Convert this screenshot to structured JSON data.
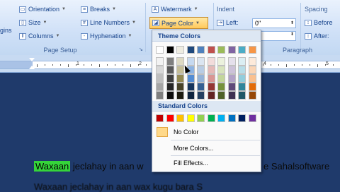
{
  "ribbon": {
    "margins_partial": "gins",
    "orientation": "Orientation",
    "size": "Size",
    "columns": "Columns",
    "breaks": "Breaks",
    "line_numbers": "Line Numbers",
    "hyphenation": "Hyphenation",
    "watermark": "Watermark",
    "page_color": "Page Color",
    "indent_label": "Indent",
    "indent_left_label": "Left:",
    "indent_left_value": "0\"",
    "spacing_label": "Spacing",
    "spacing_before": "Before",
    "spacing_after": "After:",
    "group_page_setup": "Page Setup",
    "group_paragraph": "Paragraph"
  },
  "ruler": {
    "numbers": [
      "1",
      "2",
      "3",
      "4",
      "5"
    ]
  },
  "menu": {
    "theme_header": "Theme Colors",
    "standard_header": "Standard Colors",
    "no_color": "No Color",
    "more_colors": "More Colors...",
    "fill_effects": "Fill Effects...",
    "theme_top_row": [
      "#ffffff",
      "#000000",
      "#eeece1",
      "#1f497d",
      "#4f81bd",
      "#c0504d",
      "#9bbb59",
      "#8064a2",
      "#4bacc6",
      "#f79646"
    ],
    "theme_shades": [
      [
        "#f2f2f2",
        "#7f7f7f",
        "#ddd9c3",
        "#c6d9f0",
        "#dbe5f1",
        "#f2dcdb",
        "#ebf1dd",
        "#e5e0ec",
        "#dbeef3",
        "#fdeada"
      ],
      [
        "#d8d8d8",
        "#595959",
        "#c4bd97",
        "#8db3e2",
        "#b8cce4",
        "#e5b9b7",
        "#d7e3bc",
        "#ccc1d9",
        "#b7dde8",
        "#fbd5b5"
      ],
      [
        "#bfbfbf",
        "#3f3f3f",
        "#938953",
        "#548dd4",
        "#95b3d7",
        "#d99694",
        "#c3d69b",
        "#b2a2c7",
        "#92cddc",
        "#fac08f"
      ],
      [
        "#a5a5a5",
        "#262626",
        "#494429",
        "#17365d",
        "#366092",
        "#953734",
        "#76923c",
        "#5f497a",
        "#31859b",
        "#e36c09"
      ],
      [
        "#7f7f7f",
        "#0c0c0c",
        "#1d1b10",
        "#0f243e",
        "#244061",
        "#632423",
        "#4f6128",
        "#3f3151",
        "#205867",
        "#974806"
      ]
    ],
    "standard_colors": [
      "#c00000",
      "#ff0000",
      "#ffc000",
      "#ffff00",
      "#92d050",
      "#00b050",
      "#00b0f0",
      "#0070c0",
      "#002060",
      "#7030a0"
    ]
  },
  "document": {
    "line1_highlight": "Waxaan",
    "line1_rest": " jeclahay in aan w",
    "line1_end": "e Sahalsoftware",
    "line2": "Waxaan jeclahay in aan wax kugu bara S"
  },
  "colors": {
    "page_background": "#1f3a6b",
    "highlight": "#35d43a"
  }
}
